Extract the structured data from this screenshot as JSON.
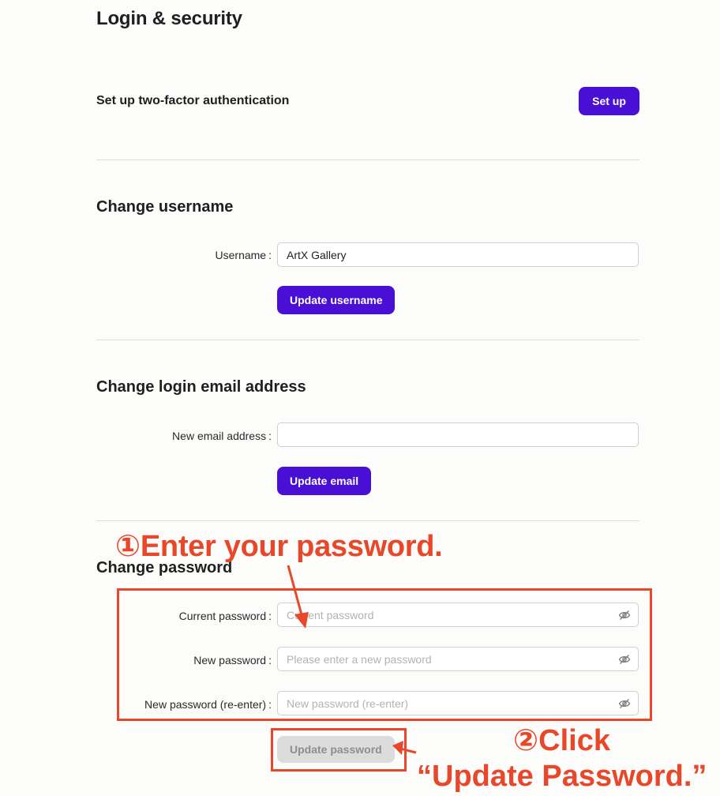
{
  "page": {
    "title": "Login & security"
  },
  "two_factor": {
    "heading": "Set up two-factor authentication",
    "button_label": "Set up"
  },
  "username": {
    "heading": "Change username",
    "field_label": "Username",
    "value": "ArtX Gallery",
    "button_label": "Update username"
  },
  "email": {
    "heading": "Change login email address",
    "field_label": "New email address",
    "value": "",
    "button_label": "Update email"
  },
  "password": {
    "heading": "Change password",
    "current_label": "Current password",
    "current_placeholder": "Current password",
    "new_label": "New password",
    "new_placeholder": "Please enter a new password",
    "confirm_label": "New password (re-enter)",
    "confirm_placeholder": "New password (re-enter)",
    "button_label": "Update password",
    "button_disabled": true
  },
  "annotations": {
    "step1": "①Enter your password.",
    "step2_line1": "②Click",
    "step2_line2": "“Update Password.”",
    "color": "#e8472a"
  },
  "colors": {
    "primary": "#4a0fd4",
    "divider": "#dedede",
    "disabled_button": "#dcdcdc"
  }
}
